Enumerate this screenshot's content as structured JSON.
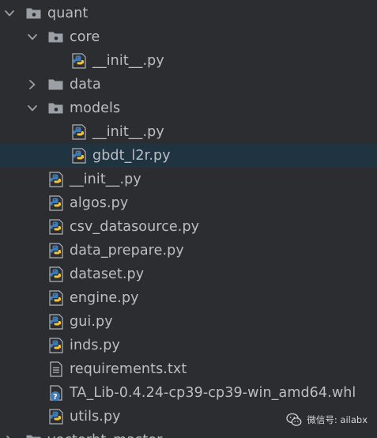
{
  "tree": [
    {
      "label": "quant",
      "kind": "folder",
      "depth": 0,
      "expanded": true
    },
    {
      "label": "core",
      "kind": "folder",
      "depth": 1,
      "expanded": true
    },
    {
      "label": "__init__.py",
      "kind": "python",
      "depth": 2
    },
    {
      "label": "data",
      "kind": "folder",
      "depth": 1,
      "expanded": false
    },
    {
      "label": "models",
      "kind": "folder",
      "depth": 1,
      "expanded": true
    },
    {
      "label": "__init__.py",
      "kind": "python",
      "depth": 2
    },
    {
      "label": "gbdt_l2r.py",
      "kind": "python",
      "depth": 2,
      "selected": true
    },
    {
      "label": "__init__.py",
      "kind": "python",
      "depth": 1
    },
    {
      "label": "algos.py",
      "kind": "python",
      "depth": 1
    },
    {
      "label": "csv_datasource.py",
      "kind": "python",
      "depth": 1
    },
    {
      "label": "data_prepare.py",
      "kind": "python",
      "depth": 1
    },
    {
      "label": "dataset.py",
      "kind": "python",
      "depth": 1
    },
    {
      "label": "engine.py",
      "kind": "python",
      "depth": 1
    },
    {
      "label": "gui.py",
      "kind": "python",
      "depth": 1
    },
    {
      "label": "inds.py",
      "kind": "python",
      "depth": 1
    },
    {
      "label": "requirements.txt",
      "kind": "text",
      "depth": 1
    },
    {
      "label": "TA_Lib-0.4.24-cp39-cp39-win_amd64.whl",
      "kind": "unknown",
      "depth": 1
    },
    {
      "label": "utils.py",
      "kind": "python",
      "depth": 1
    },
    {
      "label": "vectorbt_master",
      "kind": "folder",
      "depth": 0,
      "expanded": false
    }
  ],
  "watermark": {
    "text": "微信号: ailabx",
    "icon": "wechat-icon"
  },
  "colors": {
    "background": "#2b2d30",
    "text": "#bcbec4",
    "selection": "#1f3340",
    "folder": "#9aa0a6",
    "python_blue": "#3d7ab8",
    "python_yellow": "#f5c33b"
  }
}
